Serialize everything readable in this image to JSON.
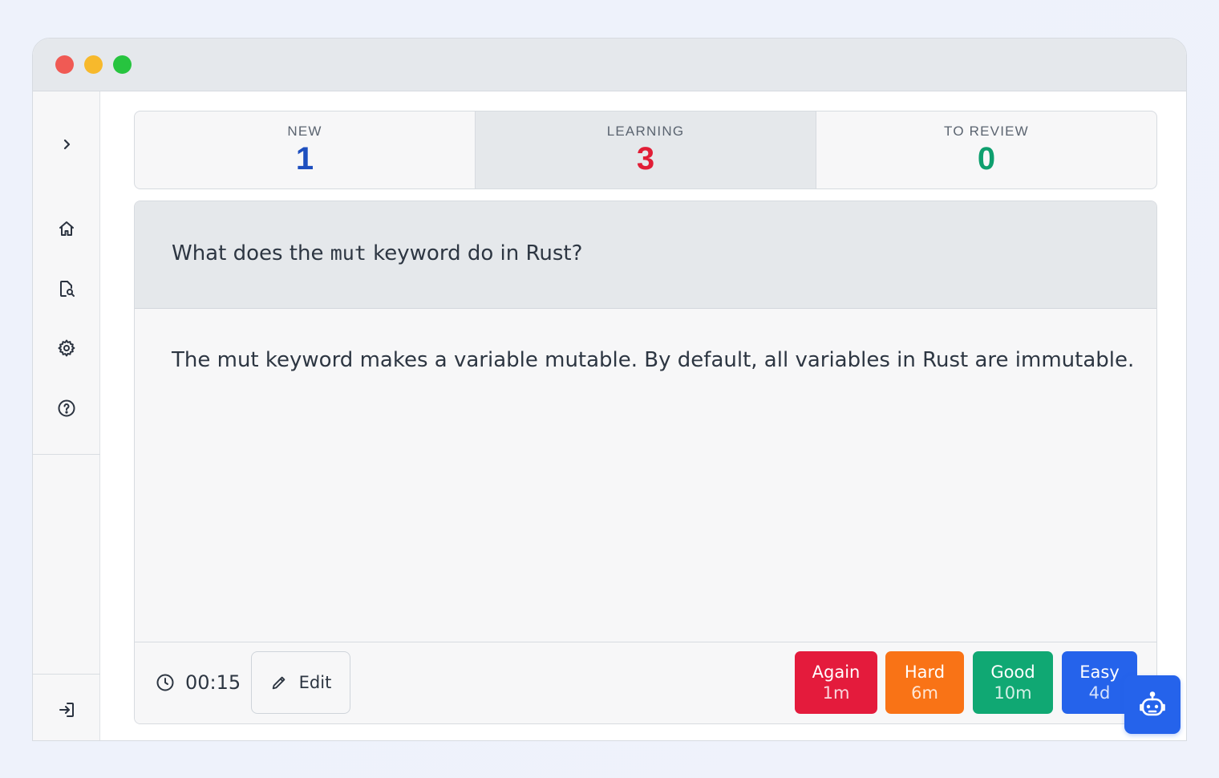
{
  "window": {
    "controls": [
      "close",
      "minimize",
      "maximize"
    ],
    "colors": {
      "close": "#f05a54",
      "minimize": "#f7b92c",
      "maximize": "#27c43f"
    }
  },
  "sidebar": {
    "items": [
      {
        "icon": "chevron-right-icon"
      },
      {
        "icon": "home-icon"
      },
      {
        "icon": "browse-search-icon"
      },
      {
        "icon": "gear-icon"
      },
      {
        "icon": "help-icon"
      },
      {
        "icon": "logout-icon"
      }
    ]
  },
  "stats": {
    "new": {
      "label": "NEW",
      "value": "1",
      "color": "#1e4fbf"
    },
    "learning": {
      "label": "LEARNING",
      "value": "3",
      "color": "#e11d36"
    },
    "review": {
      "label": "TO REVIEW",
      "value": "0",
      "color": "#0e9f6e"
    }
  },
  "card": {
    "question_before": "What does the ",
    "question_code": "mut",
    "question_after": " keyword do in Rust?",
    "answer": "The mut keyword makes a variable mutable. By default, all variables in Rust are immutable."
  },
  "footer": {
    "timer": "00:15",
    "edit_label": "Edit",
    "ratings": [
      {
        "label": "Again",
        "interval": "1m",
        "color": "#e41b3c"
      },
      {
        "label": "Hard",
        "interval": "6m",
        "color": "#f97316"
      },
      {
        "label": "Good",
        "interval": "10m",
        "color": "#10a873"
      },
      {
        "label": "Easy",
        "interval": "4d",
        "color": "#2563eb"
      }
    ]
  },
  "assistant": {
    "icon": "robot-icon",
    "color": "#2563eb"
  }
}
